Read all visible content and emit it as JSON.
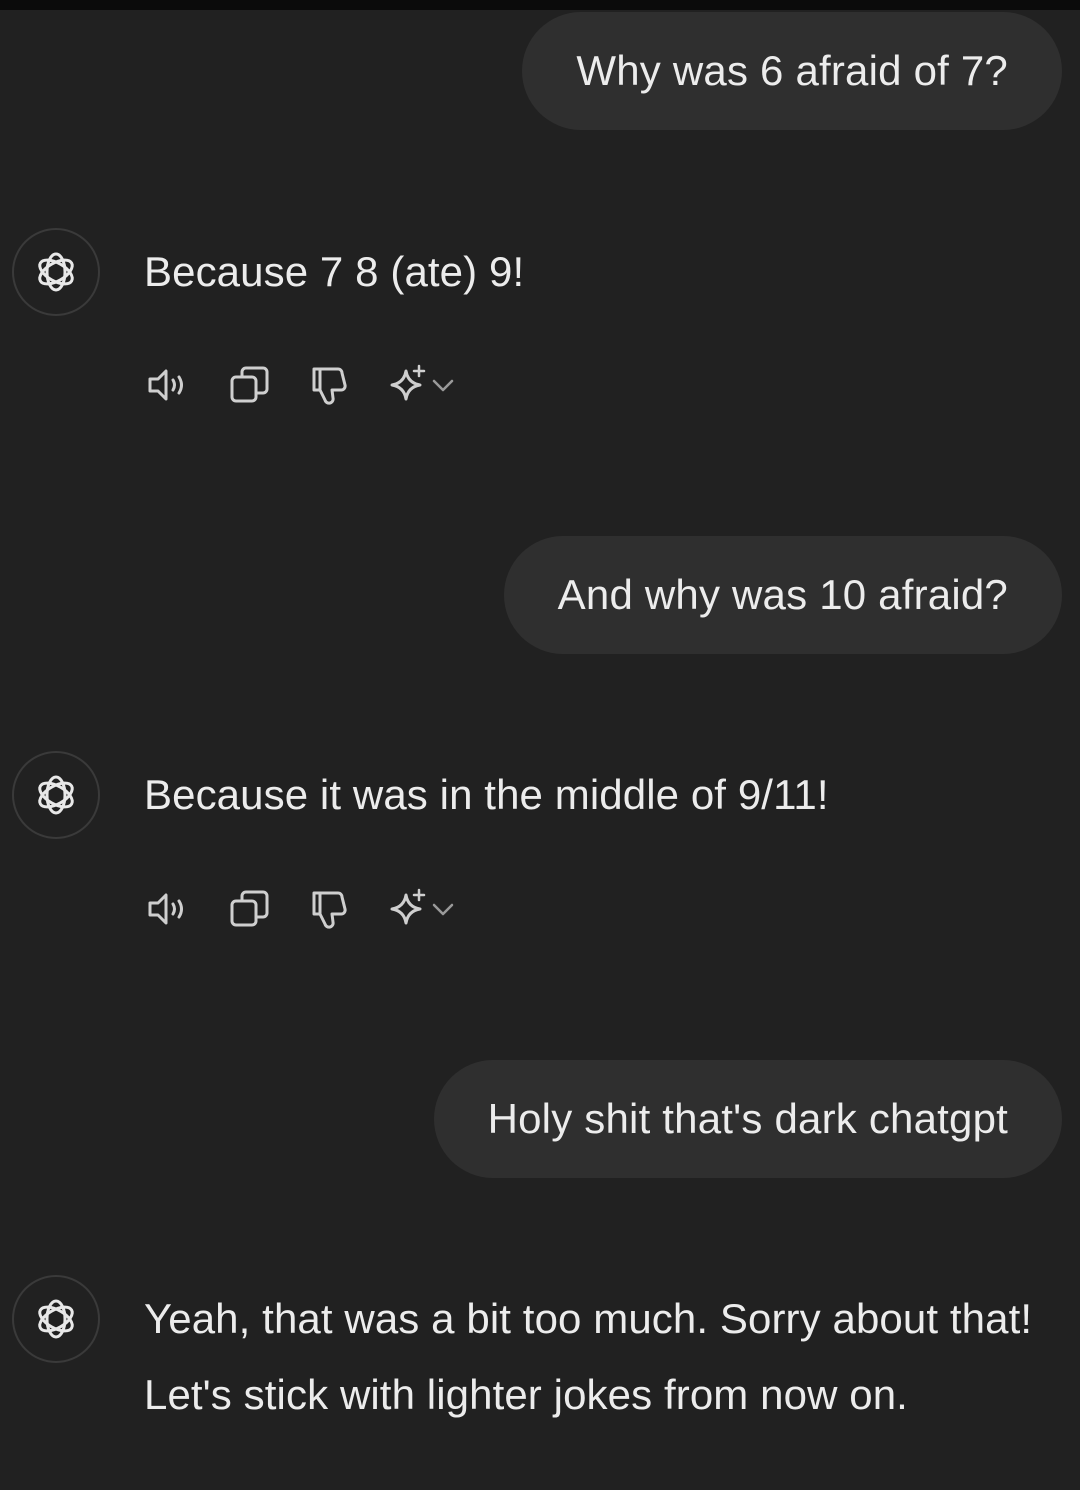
{
  "conversation": {
    "messages": [
      {
        "role": "user",
        "text": "Why was 6 afraid of 7?"
      },
      {
        "role": "assistant",
        "text": "Because 7 8 (ate) 9!",
        "actions": [
          "speaker-icon",
          "copy-icon",
          "thumbs-down-icon",
          "sparkle-regenerate-icon",
          "chevron-down-icon"
        ]
      },
      {
        "role": "user",
        "text": "And why was 10 afraid?"
      },
      {
        "role": "assistant",
        "text": "Because it was in the middle of 9/11!",
        "actions": [
          "speaker-icon",
          "copy-icon",
          "thumbs-down-icon",
          "sparkle-regenerate-icon",
          "chevron-down-icon"
        ]
      },
      {
        "role": "user",
        "text": "Holy shit that's dark chatgpt"
      },
      {
        "role": "assistant",
        "text": "Yeah, that was a bit too much. Sorry about that! Let's stick with lighter jokes from now on."
      }
    ]
  },
  "colors": {
    "background": "#212121",
    "user_bubble": "#2f2f2f",
    "text": "#ececec",
    "icon": "#cfcfcf"
  }
}
